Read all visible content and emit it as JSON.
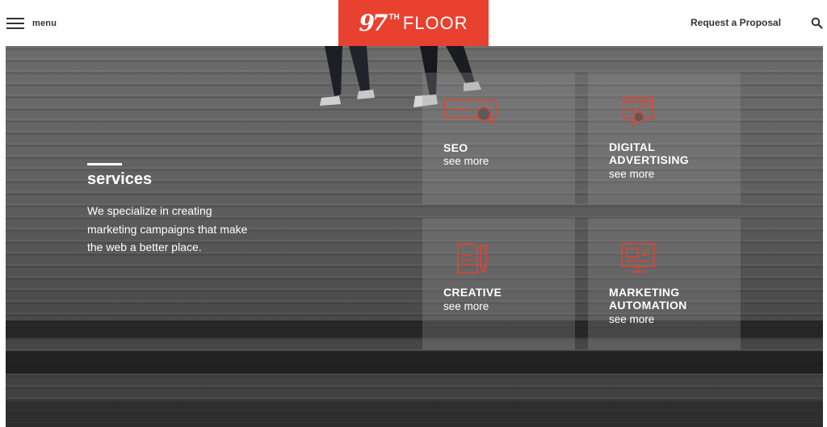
{
  "header": {
    "menu_label": "menu",
    "logo_number": "97",
    "logo_superscript": "TH",
    "logo_word": "FLOOR",
    "proposal_link": "Request a Proposal"
  },
  "hero": {
    "heading": "services",
    "description": "We specialize in creating marketing campaigns that make the web a better place."
  },
  "services": [
    {
      "title_line1": "SEO",
      "title_line2": "",
      "link": "see more",
      "icon": "seo-search-bar-icon"
    },
    {
      "title_line1": "DIGITAL",
      "title_line2": "ADVERTISING",
      "link": "see more",
      "icon": "ad-analytics-icon"
    },
    {
      "title_line1": "CREATIVE",
      "title_line2": "",
      "link": "see more",
      "icon": "document-pen-icon"
    },
    {
      "title_line1": "MARKETING",
      "title_line2": "AUTOMATION",
      "link": "see more",
      "icon": "monitor-icon"
    }
  ],
  "colors": {
    "brand_red": "#e8412f",
    "text_dark": "#333333",
    "text_light": "#ffffff"
  }
}
